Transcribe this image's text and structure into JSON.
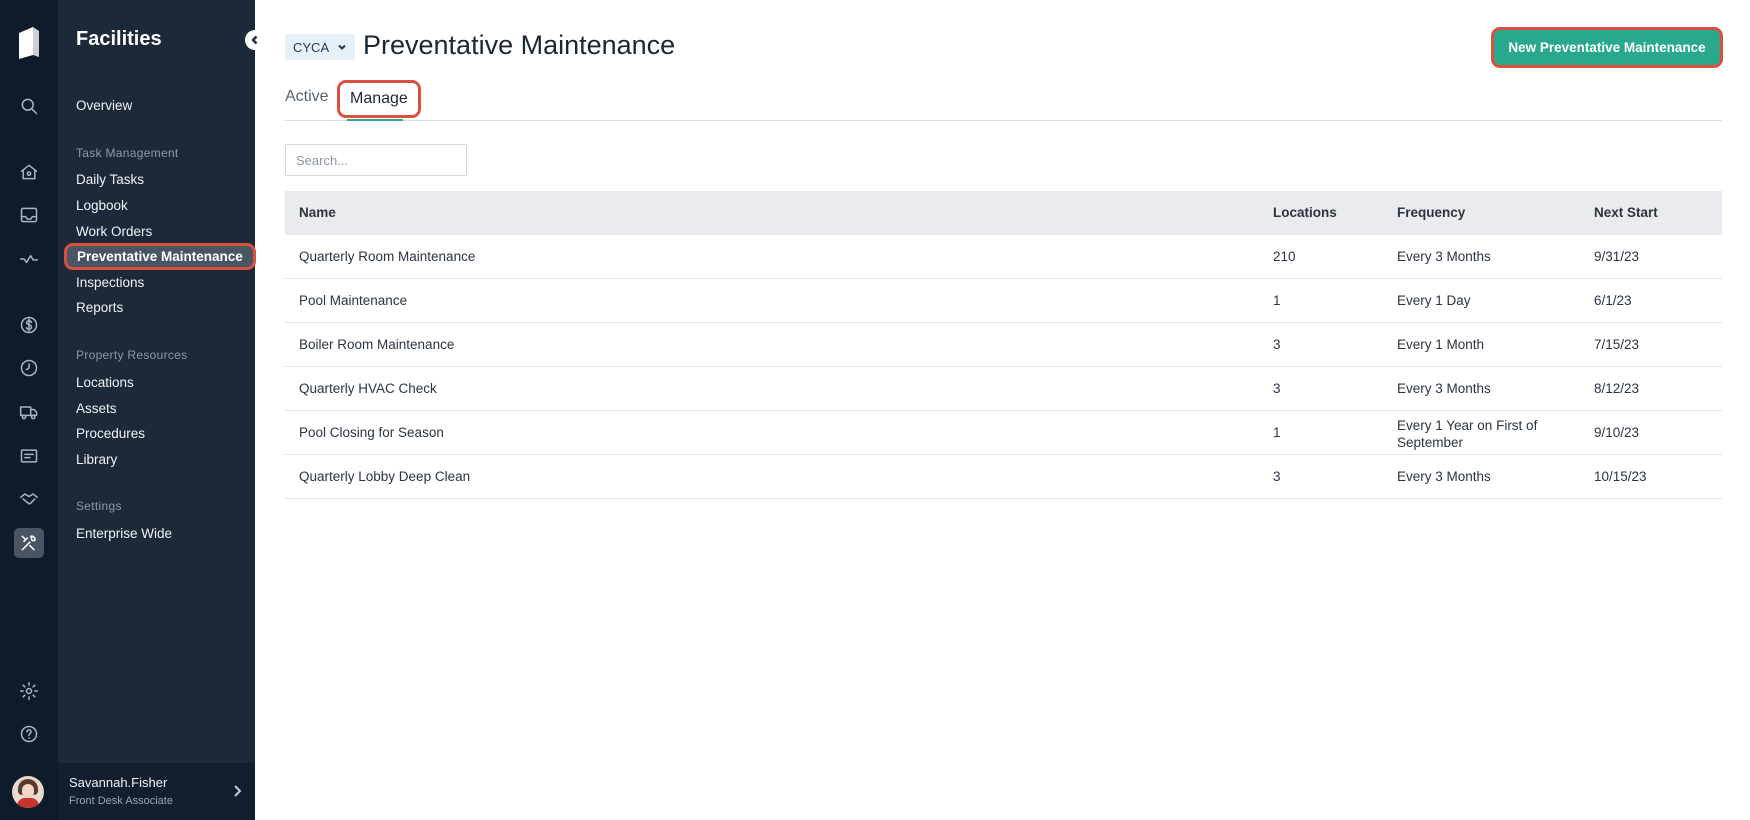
{
  "sidebar": {
    "title": "Facilities",
    "overview": "Overview",
    "task_management_heading": "Task Management",
    "daily_tasks": "Daily Tasks",
    "logbook": "Logbook",
    "work_orders": "Work Orders",
    "preventative_maintenance": "Preventative Maintenance",
    "inspections": "Inspections",
    "reports": "Reports",
    "property_resources_heading": "Property Resources",
    "locations": "Locations",
    "assets": "Assets",
    "procedures": "Procedures",
    "library": "Library",
    "settings_heading": "Settings",
    "enterprise_wide": "Enterprise Wide"
  },
  "user": {
    "name": "Savannah.Fisher",
    "role": "Front Desk Associate"
  },
  "header": {
    "org": "CYCA",
    "title": "Preventative Maintenance",
    "new_button": "New Preventative Maintenance"
  },
  "tabs": {
    "active": "Active",
    "manage": "Manage"
  },
  "search": {
    "placeholder": "Search..."
  },
  "table": {
    "columns": [
      "Name",
      "Locations",
      "Frequency",
      "Next Start"
    ],
    "rows": [
      [
        "Quarterly Room Maintenance",
        "210",
        "Every 3 Months",
        "9/31/23"
      ],
      [
        "Pool Maintenance",
        "1",
        "Every 1 Day",
        "6/1/23"
      ],
      [
        "Boiler Room Maintenance",
        "3",
        "Every 1 Month",
        "7/15/23"
      ],
      [
        "Quarterly HVAC Check",
        "3",
        "Every 3 Months",
        "8/12/23"
      ],
      [
        "Pool Closing for Season",
        "1",
        "Every 1 Year on First of September",
        "9/10/23"
      ],
      [
        "Quarterly Lobby Deep Clean",
        "3",
        "Every 3 Months",
        "10/15/23"
      ]
    ]
  },
  "colors": {
    "accent": "#2aa88d",
    "highlight": "#d9503e",
    "sidebar": "#1c2939",
    "rail": "#0f1b2b"
  }
}
